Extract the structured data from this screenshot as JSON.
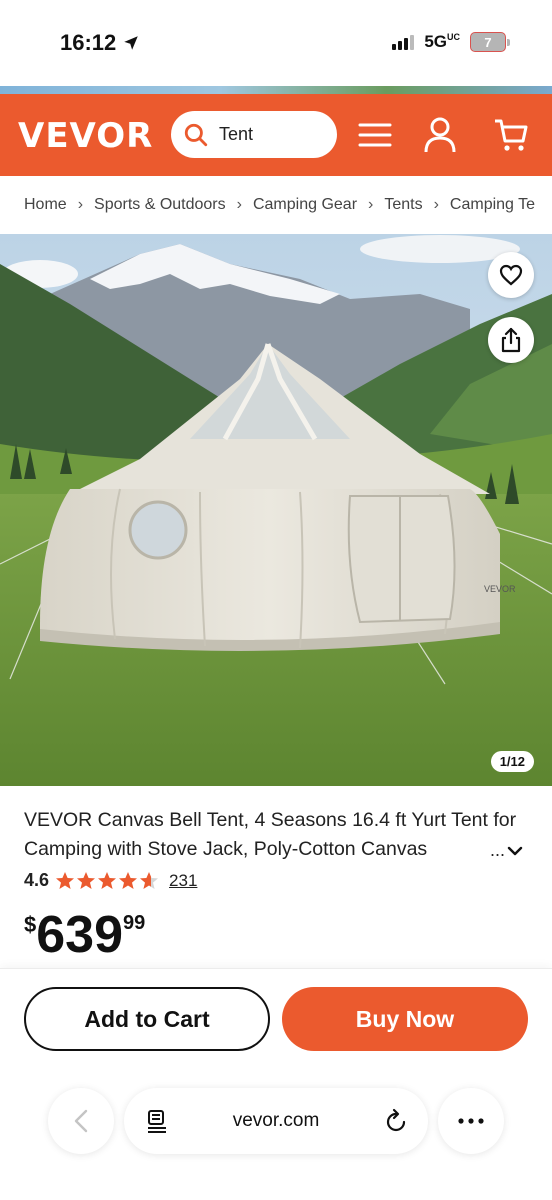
{
  "status_bar": {
    "time": "16:12",
    "network": "5G",
    "network_suffix": "UC",
    "battery": "7"
  },
  "header": {
    "logo": "VEVOR",
    "search_value": "Tent",
    "icons": [
      "search-icon",
      "menu-icon",
      "account-icon",
      "cart-icon"
    ],
    "brand_color": "#eb5a2e"
  },
  "breadcrumb": {
    "items": [
      "Home",
      "Sports & Outdoors",
      "Camping Gear",
      "Tents",
      "Camping Te"
    ]
  },
  "product": {
    "image_counter": "1/12",
    "title": "VEVOR Canvas Bell Tent, 4 Seasons 16.4 ft Yurt Tent for Camping with Stove Jack, Poly-Cotton Canvas",
    "more_label": "...",
    "rating": "4.6",
    "rating_value": 4.6,
    "review_count": "231",
    "price_currency": "$",
    "price_whole": "639",
    "price_cents": "99",
    "tent_brand_mark": "VEVOR"
  },
  "actions": {
    "add_to_cart": "Add to Cart",
    "buy_now": "Buy Now"
  },
  "browser": {
    "url": "vevor.com"
  }
}
